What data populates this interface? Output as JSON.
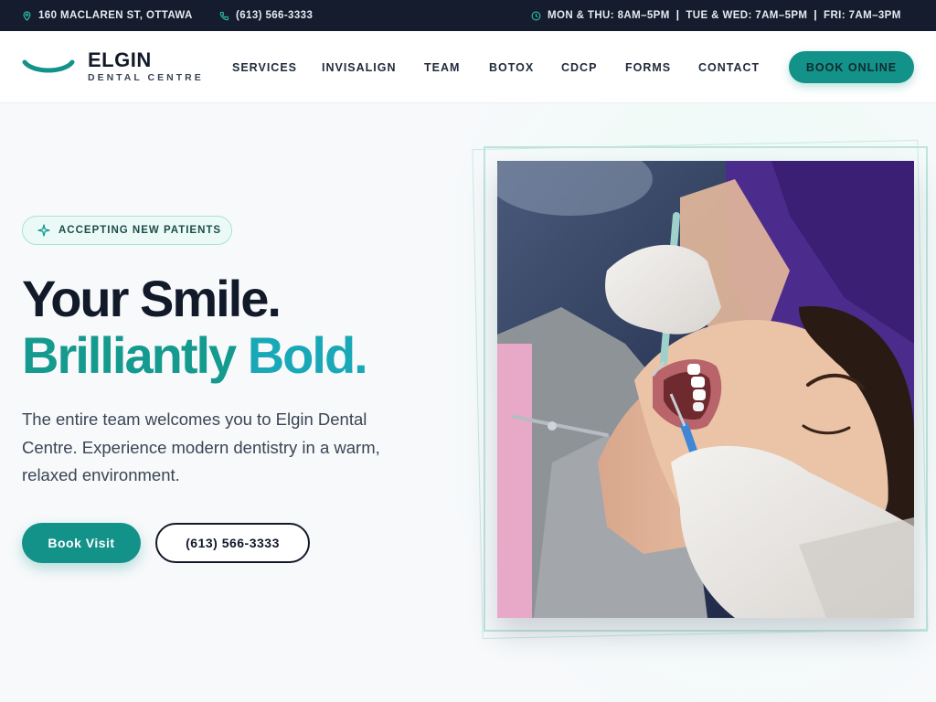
{
  "topbar": {
    "address": "160 MACLAREN ST, OTTAWA",
    "phone": "(613) 566-3333",
    "hours": [
      "MON & THU: 8AM–5PM",
      "TUE & WED: 7AM–5PM",
      "FRI: 7AM–3PM"
    ],
    "separator": "|"
  },
  "logo": {
    "name": "ELGIN",
    "subtitle": "DENTAL CENTRE"
  },
  "nav": {
    "items": [
      "SERVICES",
      "INVISALIGN",
      "TEAM",
      "BOTOX",
      "CDCP",
      "FORMS",
      "CONTACT"
    ],
    "cta": "BOOK ONLINE"
  },
  "hero": {
    "badge": "ACCEPTING NEW PATIENTS",
    "headline_line1": "Your Smile",
    "headline_dot": ".",
    "headline_line2_a": "Brilliantly",
    "headline_line2_b": "Bold",
    "lead": "The entire team welcomes you to Elgin Dental Centre. Experience modern dentistry in a warm, relaxed environment.",
    "primary_button": "Book Visit",
    "secondary_button": "(613) 566-3333"
  },
  "colors": {
    "brand_teal": "#13928a",
    "accent_cyan": "#19a8b7",
    "dark_navy": "#141c2e"
  },
  "icons": {
    "address": "map-pin-icon",
    "phone": "phone-icon",
    "hours": "clock-icon",
    "badge": "sparkle-icon"
  }
}
